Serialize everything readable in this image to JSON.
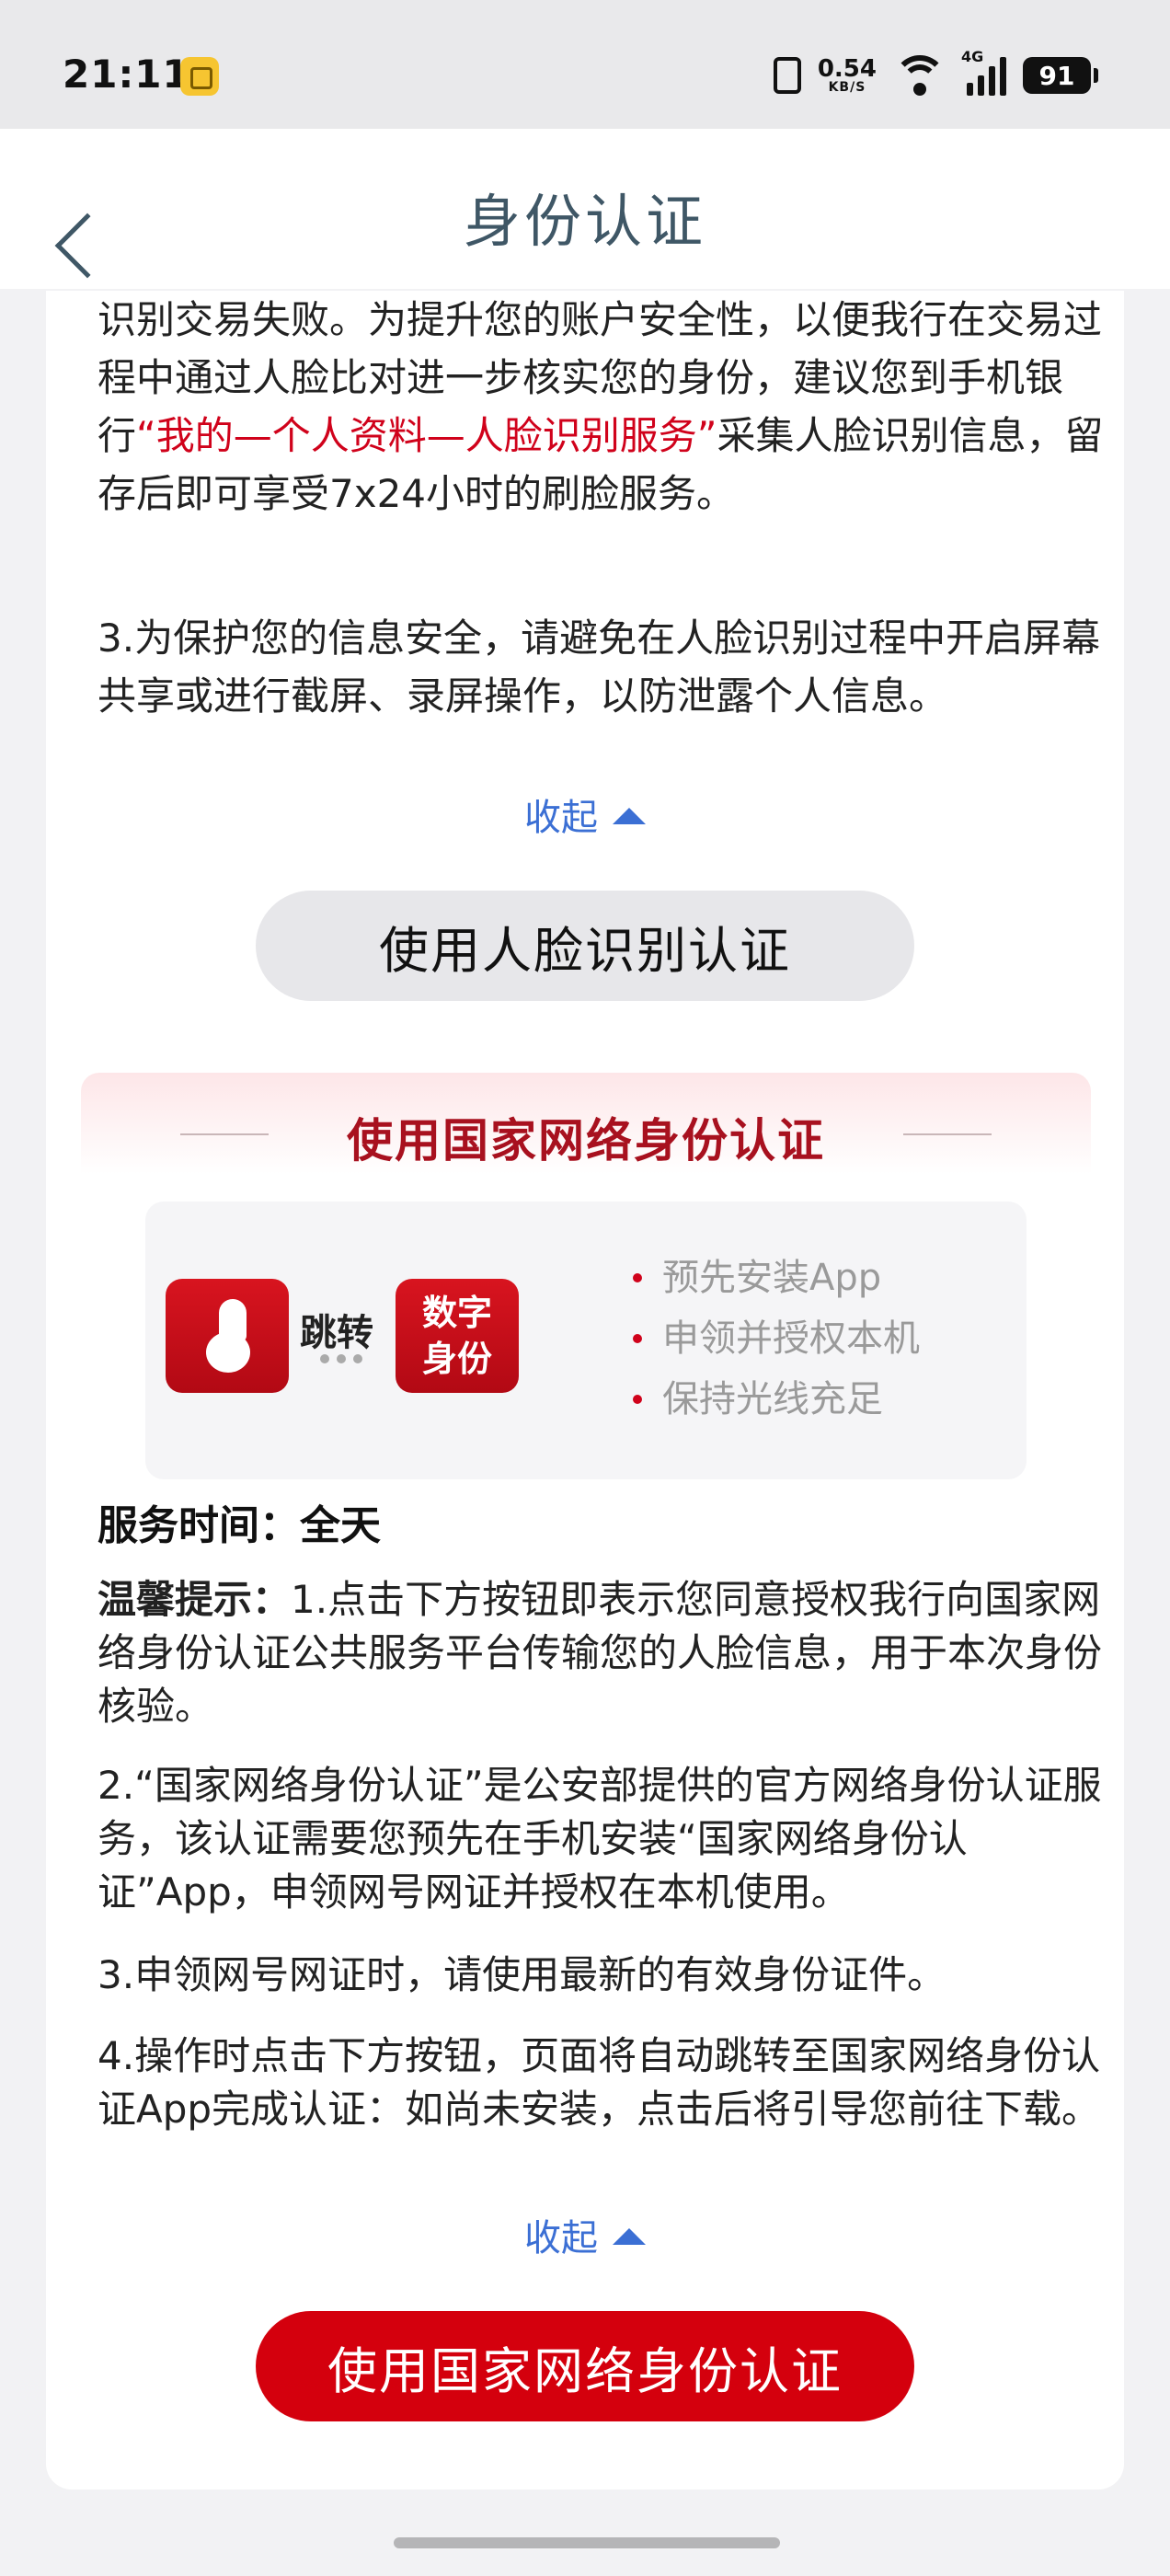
{
  "status_bar": {
    "time": "21:11",
    "net_speed": "0.54",
    "net_unit": "KB/S",
    "network_type": "4G",
    "battery": "91"
  },
  "header": {
    "title": "身份认证"
  },
  "face_section": {
    "para1_part1": "识别交易失败。为提升您的账户安全性，以便我行在交易过程中通过人脸比对进一步核实您的身份，建议您到手机银行",
    "para1_highlight": "“我的—个人资料—人脸识别服务”",
    "para1_part2": "采集人脸识别信息，留存后即可享受7x24小时的刷脸服务。",
    "para2": "3.为保护您的信息安全，请避免在人脸识别过程中开启屏幕共享或进行截屏、录屏操作，以防泄露个人信息。",
    "collapse_label": "收起",
    "button_label": "使用人脸识别认证"
  },
  "ctid_section": {
    "title": "使用国家网络身份认证",
    "jump_label": "跳转",
    "digital_logo_line1": "数字",
    "digital_logo_line2": "身份",
    "requirements": [
      "预先安装App",
      "申领并授权本机",
      "保持光线充足"
    ],
    "service_time": "服务时间：全天",
    "tip_label": "温馨提示：",
    "tip1": "1.点击下方按钮即表示您同意授权我行向国家网络身份认证公共服务平台传输您的人脸信息，用于本次身份核验。",
    "tip2": "2.“国家网络身份认证”是公安部提供的官方网络身份认证服务，该认证需要您预先在手机安装“国家网络身份认证”App，申领网号网证并授权在本机使用。",
    "tip3": "3.申领网号网证时，请使用最新的有效身份证件。",
    "tip4": "4.操作时点击下方按钮，页面将自动跳转至国家网络身份认证App完成认证：如尚未安装，点击后将引导您前往下载。",
    "collapse_label": "收起",
    "button_label": "使用国家网络身份认证"
  },
  "colors": {
    "accent_red": "#d4000d",
    "link_blue": "#3b6fd4",
    "title_gray_blue": "#3f5766"
  }
}
